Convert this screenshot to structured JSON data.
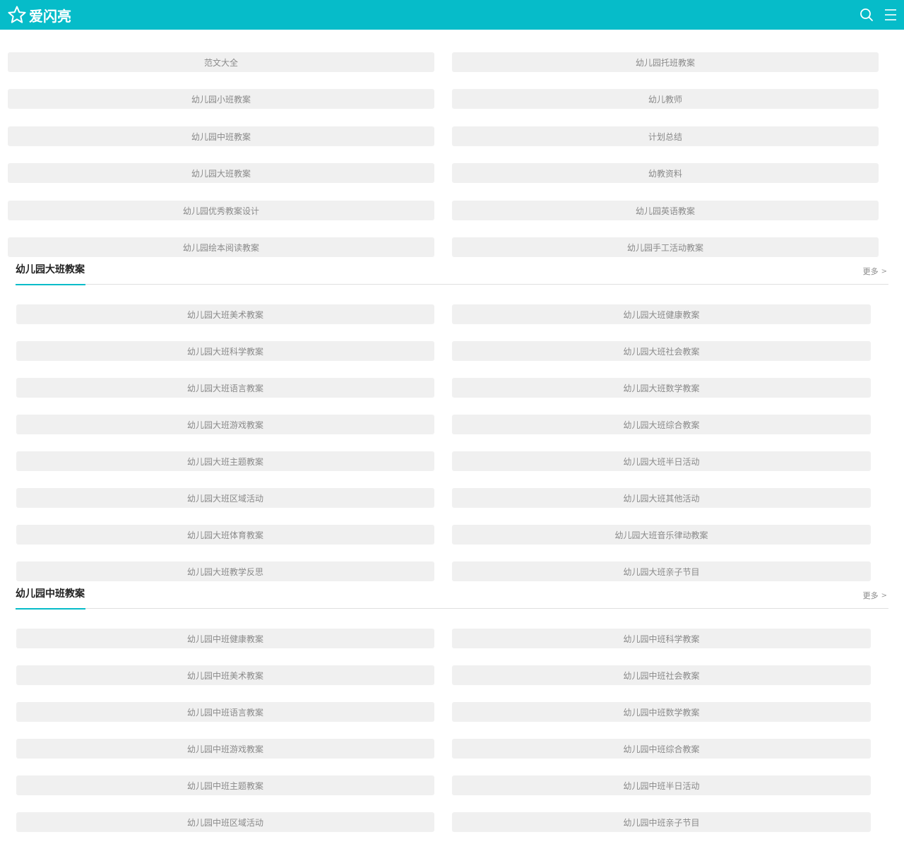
{
  "header": {
    "site_name": "爱闪亮",
    "logo_icon": "star-outline-icon",
    "search_icon": "search-icon",
    "menu_icon": "hamburger-menu-icon",
    "brand_color": "#06bcc9"
  },
  "top_grid": {
    "left": [
      "范文大全",
      "幼儿园小班教案",
      "幼儿园中班教案",
      "幼儿园大班教案",
      "幼儿园优秀教案设计",
      "幼儿园绘本阅读教案"
    ],
    "right": [
      "幼儿园托班教案",
      "幼儿教师",
      "计划总结",
      "幼教资料",
      "幼儿园英语教案",
      "幼儿园手工活动教案"
    ]
  },
  "sections": [
    {
      "title": "幼儿园大班教案",
      "more": "更多",
      "left": [
        "幼儿园大班美术教案",
        "幼儿园大班科学教案",
        "幼儿园大班语言教案",
        "幼儿园大班游戏教案",
        "幼儿园大班主题教案",
        "幼儿园大班区域活动",
        "幼儿园大班体育教案",
        "幼儿园大班教学反思"
      ],
      "right": [
        "幼儿园大班健康教案",
        "幼儿园大班社会教案",
        "幼儿园大班数学教案",
        "幼儿园大班综合教案",
        "幼儿园大班半日活动",
        "幼儿园大班其他活动",
        "幼儿园大班音乐律动教案",
        "幼儿园大班亲子节目"
      ]
    },
    {
      "title": "幼儿园中班教案",
      "more": "更多",
      "left": [
        "幼儿园中班健康教案",
        "幼儿园中班美术教案",
        "幼儿园中班语言教案",
        "幼儿园中班游戏教案",
        "幼儿园中班主题教案",
        "幼儿园中班区域活动"
      ],
      "right": [
        "幼儿园中班科学教案",
        "幼儿园中班社会教案",
        "幼儿园中班数学教案",
        "幼儿园中班综合教案",
        "幼儿园中班半日活动",
        "幼儿园中班亲子节目"
      ]
    }
  ]
}
